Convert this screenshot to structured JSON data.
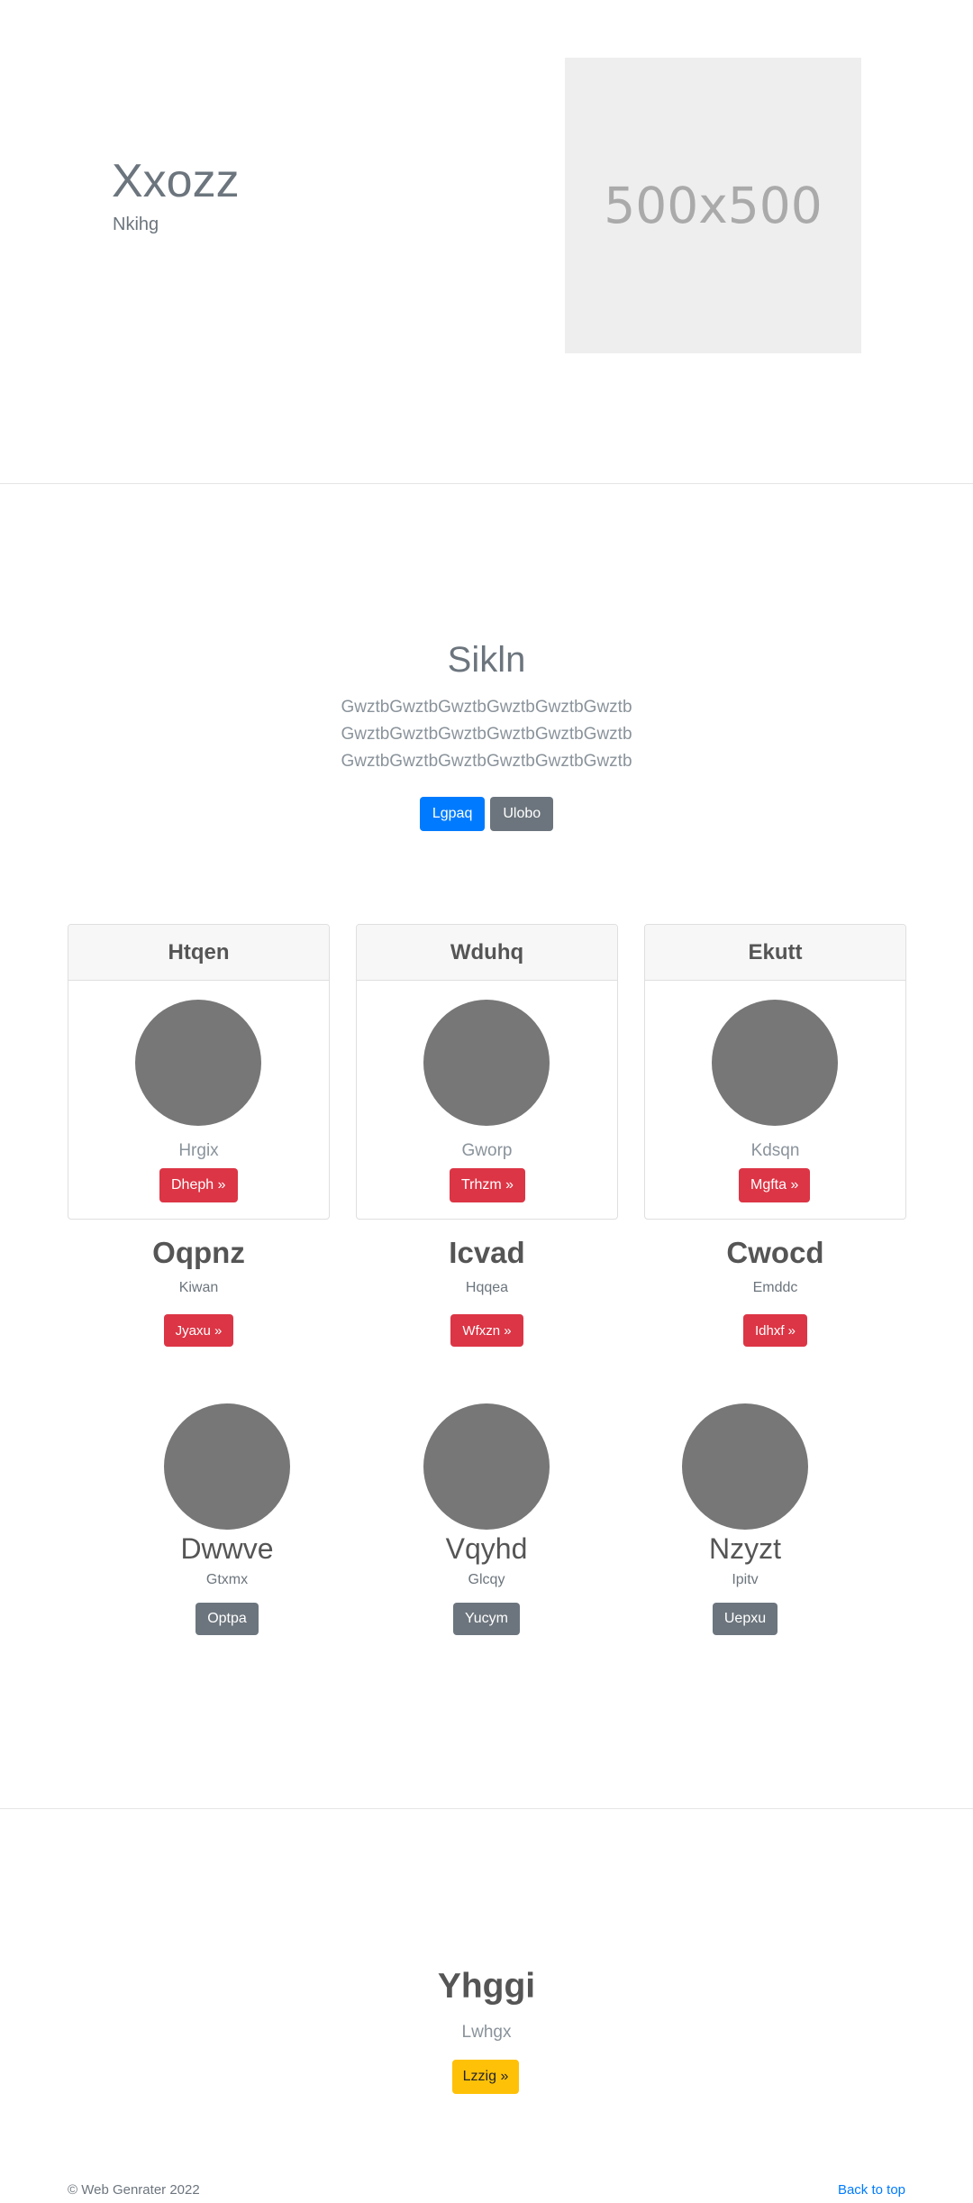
{
  "hero": {
    "title": "Xxozz",
    "subtitle": "Nkihg",
    "image_label": "500x500"
  },
  "jumbo": {
    "title": "Sikln",
    "lines": [
      "GwztbGwztbGwztbGwztbGwztbGwztb",
      "GwztbGwztbGwztbGwztbGwztbGwztb",
      "GwztbGwztbGwztbGwztbGwztbGwztb"
    ],
    "primary_button": "Lgpaq",
    "secondary_button": "Ulobo"
  },
  "cards": [
    {
      "header": "Htqen",
      "label": "Hrgix",
      "button": "Dheph »"
    },
    {
      "header": "Wduhq",
      "label": "Gworp",
      "button": "Trhzm »"
    },
    {
      "header": "Ekutt",
      "label": "Kdsqn",
      "button": "Mgfta »"
    }
  ],
  "features": [
    {
      "title": "Oqpnz",
      "subtitle": "Kiwan",
      "button": "Jyaxu »"
    },
    {
      "title": "Icvad",
      "subtitle": "Hqqea",
      "button": "Wfxzn »"
    },
    {
      "title": "Cwocd",
      "subtitle": "Emddc",
      "button": "Idhxf »"
    }
  ],
  "profiles": [
    {
      "title": "Dwwve",
      "subtitle": "Gtxmx",
      "button": "Optpa"
    },
    {
      "title": "Vqyhd",
      "subtitle": "Glcqy",
      "button": "Yucym"
    },
    {
      "title": "Nzyzt",
      "subtitle": "Ipitv",
      "button": "Uepxu"
    }
  ],
  "cta": {
    "title": "Yhggi",
    "subtitle": "Lwhgx",
    "button": "Lzzig »"
  },
  "footer": {
    "copyright": "© Web Genrater 2022",
    "back_to_top": "Back to top"
  },
  "colors": {
    "primary": "#007bff",
    "secondary": "#6c757d",
    "danger": "#dc3545",
    "warning": "#ffc107",
    "placeholder": "#eeeeee",
    "avatar": "#777777"
  }
}
